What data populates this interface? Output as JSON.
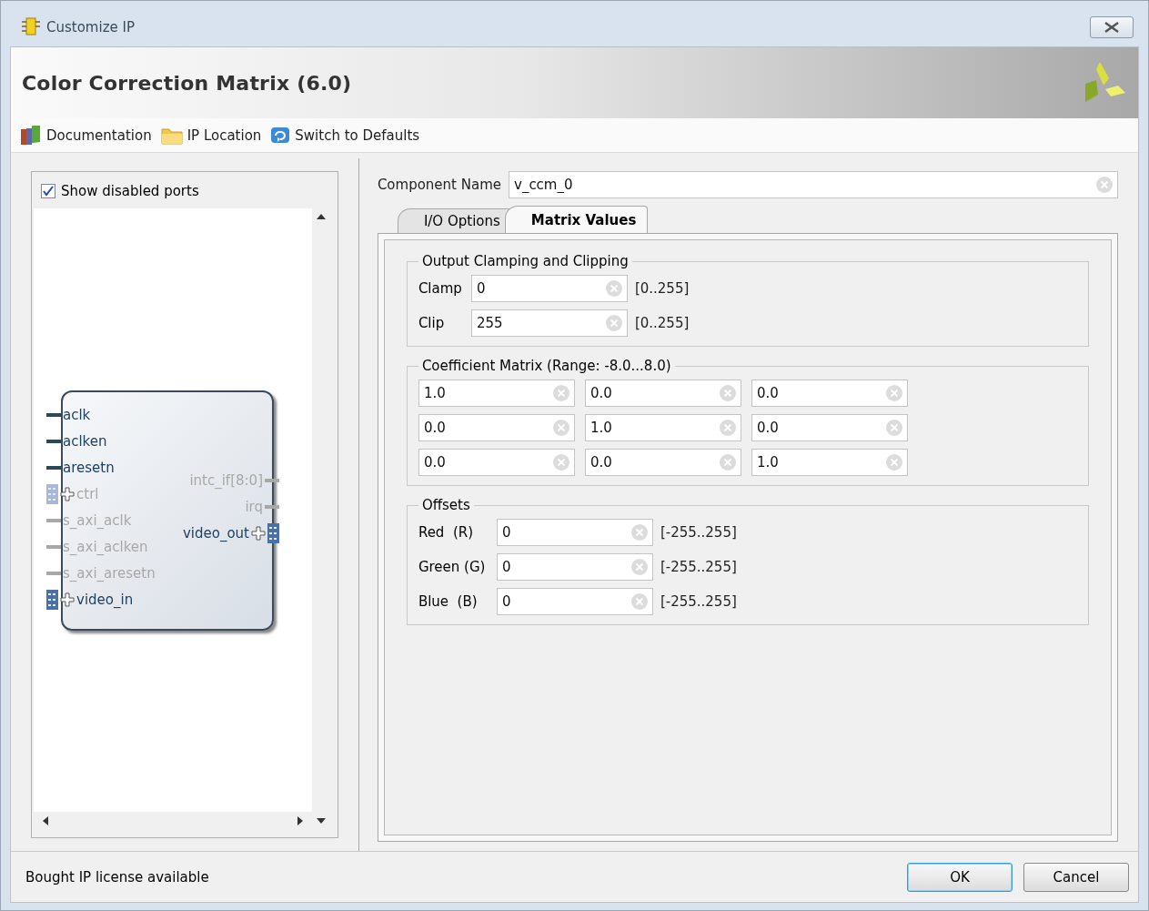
{
  "window": {
    "title": "Customize IP"
  },
  "header": {
    "title": "Color Correction Matrix (6.0)"
  },
  "toolbar": [
    {
      "label": "Documentation",
      "kind": "books"
    },
    {
      "label": "IP Location",
      "kind": "folder"
    },
    {
      "label": "Switch to Defaults",
      "kind": "reset"
    }
  ],
  "left_panel": {
    "show_disabled_ports": {
      "label": "Show disabled ports",
      "checked": true
    },
    "block": {
      "left_ports": [
        {
          "name": "aclk",
          "kind": "wire",
          "disabled": false
        },
        {
          "name": "aclken",
          "kind": "wire",
          "disabled": false
        },
        {
          "name": "aresetn",
          "kind": "wire",
          "disabled": false
        },
        {
          "name": "ctrl",
          "kind": "bus",
          "disabled": true
        },
        {
          "name": "s_axi_aclk",
          "kind": "wire",
          "disabled": true
        },
        {
          "name": "s_axi_aclken",
          "kind": "wire",
          "disabled": true
        },
        {
          "name": "s_axi_aresetn",
          "kind": "wire",
          "disabled": true
        },
        {
          "name": "video_in",
          "kind": "bus",
          "disabled": false
        }
      ],
      "right_ports": [
        {
          "name": "intc_if[8:0]",
          "kind": "wire",
          "disabled": true
        },
        {
          "name": "irq",
          "kind": "wire",
          "disabled": true
        },
        {
          "name": "video_out",
          "kind": "bus",
          "disabled": false
        }
      ]
    }
  },
  "component_name": {
    "label": "Component Name",
    "value": "v_ccm_0"
  },
  "tabs": [
    {
      "label": "I/O Options",
      "selected": false
    },
    {
      "label": "Matrix Values",
      "selected": true
    }
  ],
  "clamping": {
    "title": "Output Clamping and Clipping",
    "rows": [
      {
        "label": "Clamp",
        "value": "0",
        "range": "[0..255]"
      },
      {
        "label": "Clip",
        "value": "255",
        "range": "[0..255]"
      }
    ]
  },
  "coefficients": {
    "title": "Coefficient Matrix  (Range: -8.0...8.0)",
    "rows": [
      [
        "1.0",
        "0.0",
        "0.0"
      ],
      [
        "0.0",
        "1.0",
        "0.0"
      ],
      [
        "0.0",
        "0.0",
        "1.0"
      ]
    ]
  },
  "offsets": {
    "title": "Offsets",
    "rows": [
      {
        "label": "Red  (R)",
        "value": "0",
        "range": "[-255..255]"
      },
      {
        "label": "Green (G)",
        "value": "0",
        "range": "[-255..255]"
      },
      {
        "label": "Blue  (B)",
        "value": "0",
        "range": "[-255..255]"
      }
    ]
  },
  "status": "Bought IP license available",
  "buttons": [
    {
      "label": "OK",
      "kind": "default"
    },
    {
      "label": "Cancel",
      "kind": "normal"
    }
  ]
}
